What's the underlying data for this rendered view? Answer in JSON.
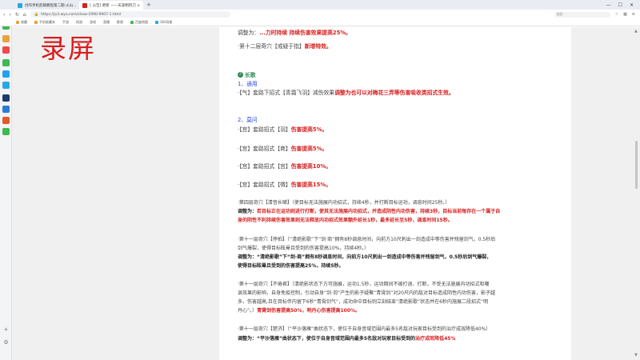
{
  "tabs": [
    {
      "label": "创作手机剪辑教程第二期-火山...",
      "active": false
    },
    {
      "label": "[ 公告]  更新 ——天涯明月刀 ×",
      "active": true
    }
  ],
  "address": {
    "url": "https://jx3.wyo.com/show-1990-9907-1.html",
    "search_placeholder": "搜索"
  },
  "bookmarks": [
    "收藏",
    "手机收藏夹",
    "手游",
    "网游",
    "游戏",
    "直播",
    "影视",
    "百度地图",
    "360导航"
  ],
  "overlay_text": "录屏",
  "article": {
    "top_line_prefix": "调整为：",
    "top_line_red": "...力时持续   持续伤害效果提高25%。",
    "l2_plain": "·第十二层奇穴【戒疑于指】",
    "l2_red": "新增特效。",
    "section_title": "长歌",
    "sub1": "1、通用",
    "l4_plain": "·【气】套路下招式【青霜飞羽】减伤效果",
    "l4_red": "调整为也可以对梅花三弄等伤害吸收类招式生效。",
    "sub2": "2、莫问",
    "skills": [
      {
        "plain": "·【宫】套路招式【羽】",
        "red": "伤害提高5%。"
      },
      {
        "plain": "·【宫】套路招式【商】",
        "red": "伤害提高5%。"
      },
      {
        "plain": "·【宫】套路招式【宫】",
        "red": "伤害提高10%。"
      },
      {
        "plain": "·【宫】套路招式【徵】",
        "red": "伤害提高15%。"
      }
    ],
    "p1": "·第四层奇穴【清音长啸】（使目标无法施展内功招式，持续4秒，并打断目标运功，调息时间25秒。）",
    "p1_label": "调整为：",
    "p1_red1": "若目标正在运功则进行打断，使其无法施展内功招式，并造成阴性内功伤害，持续3秒，目标当前每存在一个属于自",
    "p1_red2": "身的阴性不利持续伤害效果则无法释放内功招式效果额外延长1秒，最多延长至5秒，调息时间15秒。",
    "p2_1": "·第十一层奇穴【停拍】（“清绝影歌”下“剑·商”拥有8秒调息时间，向前方10尺刺出一剑造成中等伤害并残留剑气，0.5秒后",
    "p2_2": "剑气爆裂，使得目标眩晕且受到的伤害提高10%，持续4秒。）",
    "p2_label": "调整为：",
    "p2_red1": "“清绝影歌”下“剑·商”拥有8秒调息时间，向前方10尺刺出一剑造成中等伤害并残留剑气，0.5秒后剑气爆裂，",
    "p2_red2": "使得目标眩晕且受到的伤害提高25%，持续5秒。",
    "p3_1": "·第十一层奇穴【不倦君】（清绝影状态下方可施展，运功1.5秒，运功期间不被打退、打断，不受无法施展内功招式和嘲",
    "p3_2": "讽效果的影响，自身免疫控制，引动自身“剑·羽”产生的影子疑聚“青霄剑”对20尺内的敌对目标造成阴性内功伤害，影子越",
    "p3_3": "多，伤害越高,且在目标伴内留下6秒“青霄剑气”，成功命中目标则立刻结束“清绝影歌”状态并在6秒内施展二段招式“明",
    "p3_4a": "丹心”。）",
    "p3_4red": "青霄剑伤害提高50%，明丹心伤害提高100%。",
    "p4_1": "·第十一层奇穴【楚济】（“平沙落雁”曲状态下，使位于自身音域范围内最多5名敌对玩家目标受到的治疗成效降低40%）",
    "p4_label": "调整为：",
    "p4_bold": "“平沙落雁”曲状态下，使位于自身音域范围内最多5名敌对玩家目标受到的",
    "p4_red": "治疗成效降低45%"
  },
  "colors": {
    "accent_red": "#d81e1e",
    "heading_green": "#2e8b57",
    "sub_blue": "#2a4bd7"
  }
}
